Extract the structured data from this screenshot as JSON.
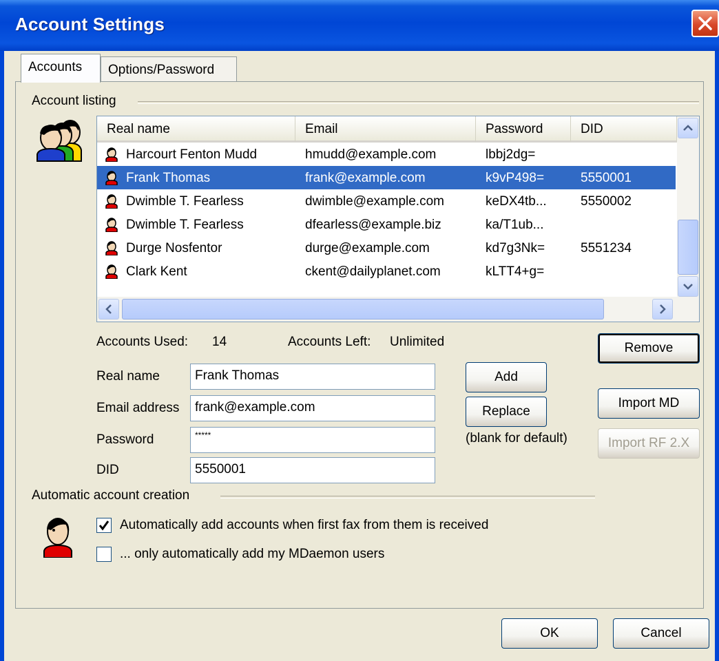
{
  "window": {
    "title": "Account Settings"
  },
  "tabs": [
    {
      "label": "Accounts"
    },
    {
      "label": "Options/Password"
    }
  ],
  "account_listing": {
    "label": "Account listing",
    "columns": [
      "Real name",
      "Email",
      "Password",
      "DID"
    ],
    "rows": [
      {
        "name": "Harcourt Fenton Mudd",
        "email": "hmudd@example.com",
        "password": "lbbj2dg=",
        "did": ""
      },
      {
        "name": "Frank Thomas",
        "email": "frank@example.com",
        "password": "k9vP498=",
        "did": "5550001",
        "selected": true
      },
      {
        "name": "Dwimble T. Fearless",
        "email": "dwimble@example.com",
        "password": "keDX4tb...",
        "did": "5550002"
      },
      {
        "name": "Dwimble T. Fearless",
        "email": "dfearless@example.biz",
        "password": "ka/T1ub...",
        "did": ""
      },
      {
        "name": "Durge Nosfentor",
        "email": "durge@example.com",
        "password": "kd7g3Nk=",
        "did": "5551234"
      },
      {
        "name": "Clark Kent",
        "email": "ckent@dailyplanet.com",
        "password": "kLTT4+g=",
        "did": ""
      }
    ],
    "accounts_used_label": "Accounts Used:",
    "accounts_used_value": "14",
    "accounts_left_label": "Accounts Left:",
    "accounts_left_value": "Unlimited"
  },
  "form": {
    "real_name_label": "Real name",
    "real_name_value": "Frank Thomas",
    "email_label": "Email address",
    "email_value": "frank@example.com",
    "password_label": "Password",
    "password_value": "*****",
    "did_label": "DID",
    "did_value": "5550001",
    "blank_hint": "(blank for default)"
  },
  "buttons": {
    "remove": "Remove",
    "add": "Add",
    "replace": "Replace",
    "import_md": "Import MD",
    "import_rf": "Import RF 2.X",
    "ok": "OK",
    "cancel": "Cancel"
  },
  "auto_creation": {
    "label": "Automatic account creation",
    "auto_add_label": "Automatically add accounts when first fax from them is received",
    "auto_add_checked": true,
    "only_mdaemon_label": "... only automatically add my MDaemon users",
    "only_mdaemon_checked": false
  },
  "icons": [
    "close-icon",
    "users-group-icon",
    "user-icon",
    "scroll-up-icon",
    "scroll-down-icon",
    "scroll-left-icon",
    "scroll-right-icon",
    "checkmark-icon"
  ],
  "colors": {
    "titlebar": "#0046D5",
    "selection": "#316AC5",
    "dialog_bg": "#ECE9D8",
    "close_button": "#D8492B"
  }
}
